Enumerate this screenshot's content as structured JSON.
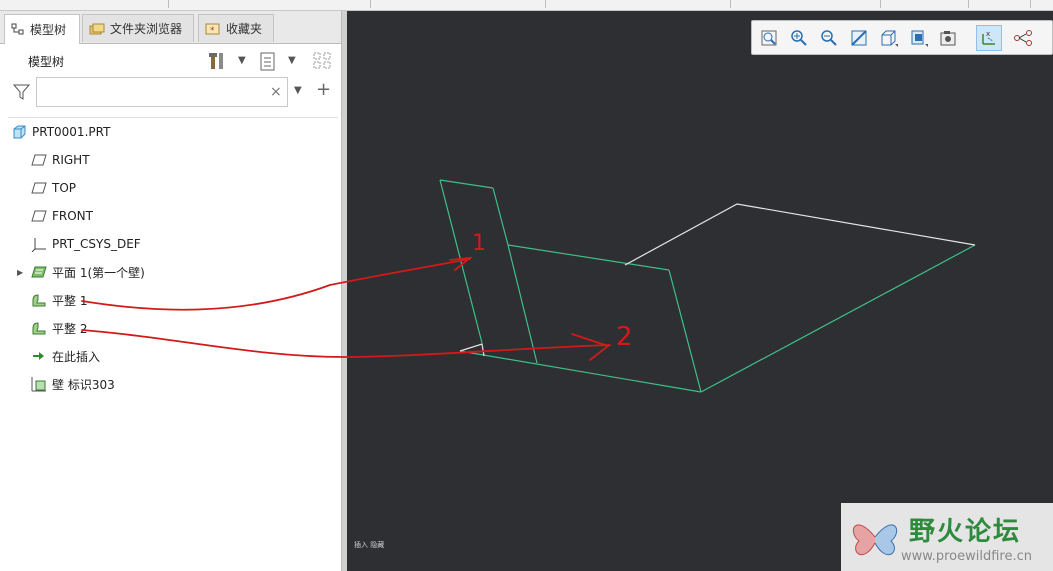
{
  "tabs": [
    {
      "label": "模型树",
      "icon": "model-tree-icon",
      "active": true
    },
    {
      "label": "文件夹浏览器",
      "icon": "folder-browser-icon",
      "active": false
    },
    {
      "label": "收藏夹",
      "icon": "favorites-icon",
      "active": false
    }
  ],
  "panel": {
    "title": "模型树",
    "search": {
      "value": "",
      "placeholder": ""
    }
  },
  "tree": [
    {
      "label": "PRT0001.PRT",
      "icon": "part-icon",
      "expandable": false
    },
    {
      "label": "RIGHT",
      "icon": "datum-plane-icon",
      "expandable": false
    },
    {
      "label": "TOP",
      "icon": "datum-plane-icon",
      "expandable": false
    },
    {
      "label": "FRONT",
      "icon": "datum-plane-icon",
      "expandable": false
    },
    {
      "label": "PRT_CSYS_DEF",
      "icon": "csys-icon",
      "expandable": false
    },
    {
      "label": "平面 1(第一个壁)",
      "icon": "planar-wall-icon",
      "expandable": true
    },
    {
      "label": "平整 1",
      "icon": "flat-wall-icon",
      "expandable": false
    },
    {
      "label": "平整 2",
      "icon": "flat-wall-icon",
      "expandable": false
    },
    {
      "label": "在此插入",
      "icon": "insert-here-arrow-icon",
      "expandable": false
    },
    {
      "label": "壁 标识303",
      "icon": "wall-feature-icon",
      "expandable": false
    }
  ],
  "viewport": {
    "status_text": "插入 隐藏",
    "toolbar": [
      "refit-icon",
      "zoom-in-icon",
      "zoom-out-icon",
      "repaint-icon",
      "saved-views-icon",
      "display-style-icon",
      "view-manager-icon",
      "datum-display-icon",
      "spin-center-icon",
      "annotation-display-icon"
    ],
    "annotations": [
      "1",
      "2"
    ],
    "colors": {
      "background": "#2d2f33",
      "edge_green": "#3fbf86",
      "edge_white": "#e6e6e6",
      "annotation_red": "#d11a1a"
    }
  },
  "watermark": {
    "title": "野火论坛",
    "url": "www.proewildfire.cn"
  }
}
